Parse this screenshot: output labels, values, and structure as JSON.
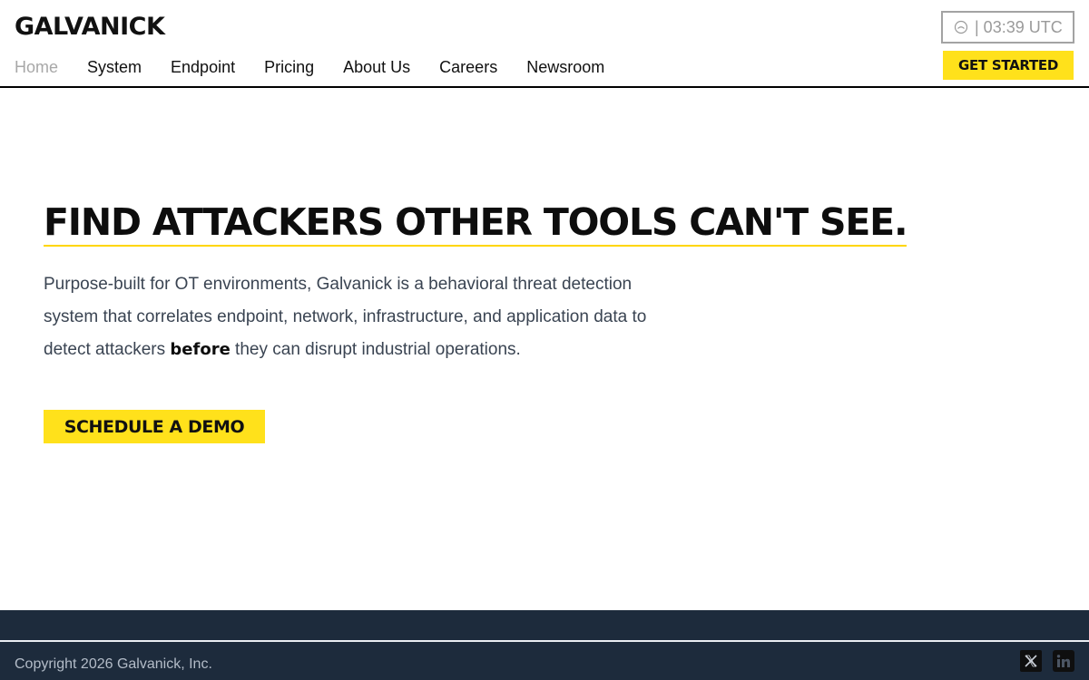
{
  "header": {
    "brand": "GALVANICK",
    "nav": [
      "Home",
      "System",
      "Endpoint",
      "Pricing",
      "About Us",
      "Careers",
      "Newsroom"
    ],
    "active_nav": "Home",
    "clock_icon": "clock-icon",
    "clock_text": "| 03:39 UTC",
    "cta_label": "GET STARTED"
  },
  "hero": {
    "title": "FIND ATTACKERS OTHER TOOLS CAN'T SEE.",
    "text_before": "Purpose-built for OT environments, Galvanick is a behavioral threat detection system that correlates endpoint, network, infrastructure, and application data to detect attackers ",
    "text_bold": "before",
    "text_after": " they can disrupt industrial operations.",
    "cta_label": "SCHEDULE A DEMO"
  },
  "footer": {
    "copyright": "Copyright 2026 Galvanick, Inc.",
    "social": [
      "x-icon",
      "linkedin-icon"
    ]
  },
  "colors": {
    "accent": "#ffe11b",
    "footer_bg": "#1d2b3c",
    "title_underline": "#ffd600"
  }
}
